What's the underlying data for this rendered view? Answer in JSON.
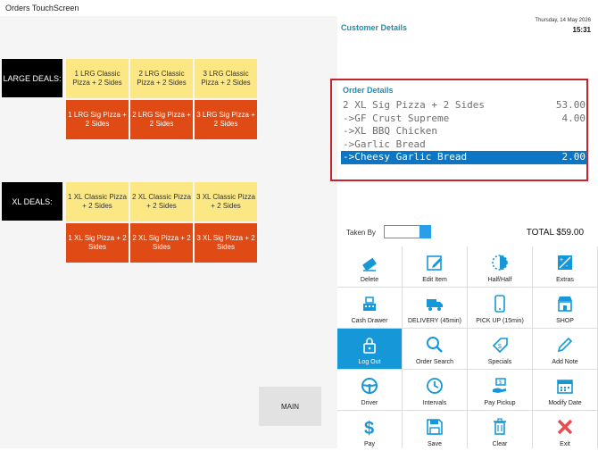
{
  "window": {
    "title": "Orders TouchScreen"
  },
  "categories": [
    {
      "label": "LARGE DEALS:"
    },
    {
      "label": "XL DEALS:"
    }
  ],
  "large_deals": {
    "row1": [
      "1 LRG Classic Pizza + 2 Sides",
      "2 LRG Classic Pizza + 2 Sides",
      "3 LRG Classic Pizza + 2 Sides"
    ],
    "row2": [
      "1 LRG Sig Pizza + 2 Sides",
      "2 LRG Sig Pizza + 2 Sides",
      "3 LRG Sig Pizza + 2 Sides"
    ]
  },
  "xl_deals": {
    "row1": [
      "1 XL Classic Pizza + 2 Sides",
      "2 XL Classic Pizza + 2 Sides",
      "3 XL Classic Pizza + 2 Sides"
    ],
    "row2": [
      "1 XL Sig Pizza + 2 Sides",
      "2 XL Sig Pizza + 2 Sides",
      "3 XL Sig Pizza + 2 Sides"
    ]
  },
  "main_button": "MAIN",
  "customer": {
    "title": "Customer Details",
    "date": "Thursday, 14 May 2026",
    "time": "15:31"
  },
  "order": {
    "title": "Order Details",
    "lines": [
      {
        "text": "2 XL Sig Pizza + 2 Sides",
        "price": "53.00",
        "selected": false
      },
      {
        "text": "->GF Crust Supreme",
        "price": "4.00",
        "selected": false
      },
      {
        "text": "->XL BBQ Chicken",
        "price": "",
        "selected": false
      },
      {
        "text": "->Garlic Bread",
        "price": "",
        "selected": false
      },
      {
        "text": "->Cheesy Garlic Bread",
        "price": "2.00",
        "selected": true
      }
    ]
  },
  "taken_by": {
    "label": "Taken By"
  },
  "total": {
    "text": "TOTAL  $59.00"
  },
  "actions": [
    {
      "label": "Delete",
      "icon": "eraser-icon"
    },
    {
      "label": "Edit Item",
      "icon": "edit-icon"
    },
    {
      "label": "Half/Half",
      "icon": "half-circle-icon"
    },
    {
      "label": "Extras",
      "icon": "extras-icon"
    },
    {
      "label": "Cash Drawer",
      "icon": "cash-register-icon"
    },
    {
      "label": "DELIVERY (45min)",
      "icon": "truck-icon"
    },
    {
      "label": "PICK UP (15min)",
      "icon": "phone-icon"
    },
    {
      "label": "SHOP",
      "icon": "shop-icon"
    },
    {
      "label": "Log Out",
      "icon": "lock-icon",
      "active": true
    },
    {
      "label": "Order Search",
      "icon": "search-icon"
    },
    {
      "label": "Specials",
      "icon": "tag-icon"
    },
    {
      "label": "Add Note",
      "icon": "pencil-icon"
    },
    {
      "label": "Driver",
      "icon": "steering-wheel-icon"
    },
    {
      "label": "Intervals",
      "icon": "clock-plus-icon"
    },
    {
      "label": "Pay Pickup",
      "icon": "hand-money-icon"
    },
    {
      "label": "Modify Date",
      "icon": "calendar-icon"
    },
    {
      "label": "Pay",
      "icon": "dollar-icon"
    },
    {
      "label": "Save",
      "icon": "save-icon"
    },
    {
      "label": "Clear",
      "icon": "trash-icon"
    },
    {
      "label": "Exit",
      "icon": "close-icon"
    }
  ],
  "colors": {
    "accent": "#1597d8",
    "heading": "#1f8db4",
    "yellow_tile": "#fbe784",
    "orange_tile": "#e04a14",
    "highlight_border": "#c0262c"
  }
}
